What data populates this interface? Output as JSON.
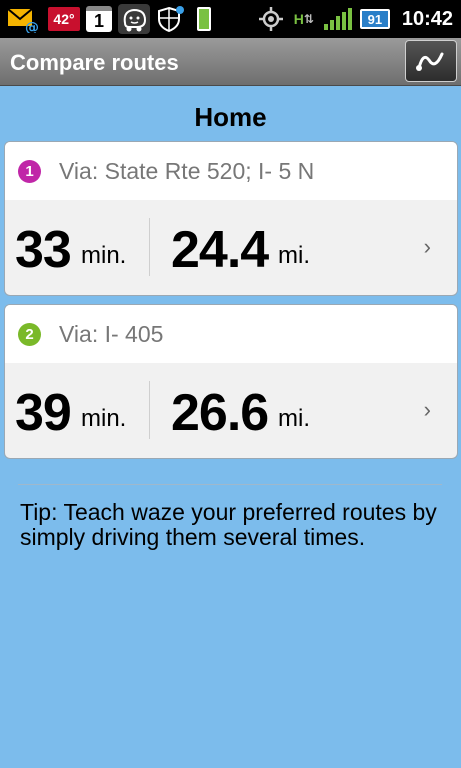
{
  "status_bar": {
    "temperature": "42°",
    "calendar_day": "1",
    "battery": "91",
    "time": "10:42",
    "data_indicator": "H"
  },
  "header": {
    "title": "Compare routes"
  },
  "destination": "Home",
  "routes": [
    {
      "number": "1",
      "badge_color": "#c026a8",
      "via": "Via: State Rte 520; I- 5 N",
      "time": "33",
      "time_unit": "min.",
      "distance": "24.4",
      "distance_unit": "mi."
    },
    {
      "number": "2",
      "badge_color": "#7ab929",
      "via": "Via: I- 405",
      "time": "39",
      "time_unit": "min.",
      "distance": "26.6",
      "distance_unit": "mi."
    }
  ],
  "tip": "Tip: Teach waze your preferred routes by simply driving them several times.",
  "colors": {
    "background": "#7cbcec",
    "header": "#808080"
  }
}
